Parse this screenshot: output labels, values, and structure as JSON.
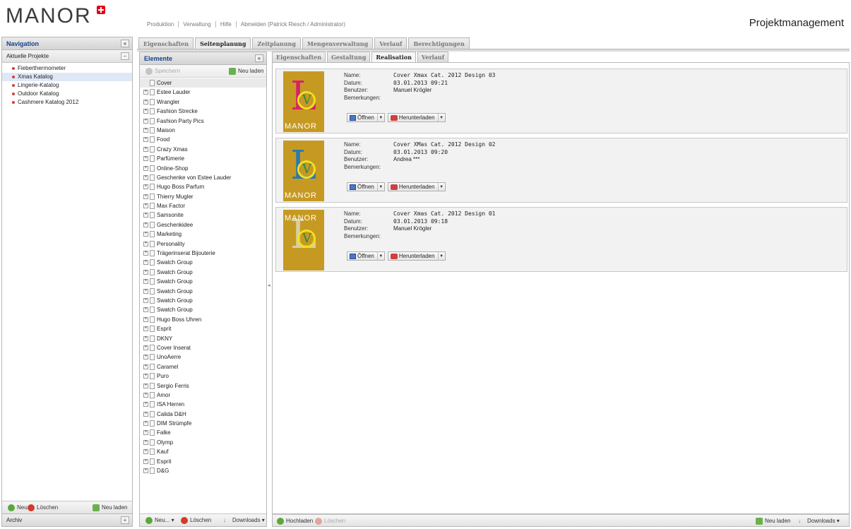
{
  "header": {
    "logo": "MANOR",
    "app_title": "Projektmanagement",
    "topnav": [
      "Produktion",
      "Verwaltung",
      "Hilfe",
      "Abmelden (Patrick Riesch / Administrator)"
    ]
  },
  "navigation": {
    "title": "Navigation",
    "section": "Aktuelle Projekte",
    "projects": [
      "Fieberthermometer",
      "Xmas Katalog",
      "Lingerie-Katalog",
      "Outdoor Katalog",
      "Cashmere Katalog 2012"
    ],
    "selected_project": "Xmas Katalog",
    "footer": {
      "new": "Neu",
      "delete": "Löschen",
      "reload": "Neu laden"
    },
    "archive": "Archiv"
  },
  "main_tabs": [
    "Eigenschaften",
    "Seitenplanung",
    "Zeitplanung",
    "Mengenverwaltung",
    "Verlauf",
    "Berechtigungen"
  ],
  "main_tab_active": "Seitenplanung",
  "elements": {
    "title": "Elemente",
    "save": "Speichern",
    "reload": "Neu laden",
    "items": [
      "Cover",
      "Estee Lauder",
      "Wrangler",
      "Fashion Strecke",
      "Fashion Party Pics",
      "Maison",
      "Food",
      "Crazy Xmas",
      "Parfümerie",
      "Online-Shop",
      "Geschenke von Estee Lauder",
      "Hugo Boss Parfum",
      "Thierry Mugler",
      "Max Factor",
      "Samsonite",
      "Geschenkidee",
      "Marketing",
      "Personality",
      "Trägerinserat Bijouterie",
      "Swatch Group",
      "Swatch Group",
      "Swatch Group",
      "Swatch Group",
      "Swatch Group",
      "Swatch Group",
      "Hugo Boss Uhren",
      "Esprit",
      "DKNY",
      "Cover Inserat",
      "UnoAerre",
      "Caramel",
      "Puro",
      "Sergio Ferris",
      "Amor",
      "ISA Herren",
      "Calida D&H",
      "DIM Strümpfe",
      "Falke",
      "Olymp",
      "Kauf",
      "Esprit",
      "D&G"
    ],
    "footer": {
      "new": "Neu...",
      "delete": "Löschen",
      "downloads": "Downloads"
    }
  },
  "sub_tabs": [
    "Eigenschaften",
    "Gestaltung",
    "Realisation",
    "Verlauf"
  ],
  "sub_tab_active": "Realisation",
  "labels": {
    "name": "Name:",
    "date": "Datum:",
    "user": "Benutzer:",
    "remarks": "Bemerkungen:",
    "open": "Öffnen",
    "download": "Herunterladen"
  },
  "designs": [
    {
      "name": "Cover Xmax Cat. 2012 Design 03",
      "date": "03.01.2013 09:21",
      "user": "Manuel Krögler",
      "remarks": "",
      "thumb_logo": "MANOR",
      "letter_color": "#d8206a"
    },
    {
      "name": "Cover XMas Cat. 2012 Design 02",
      "date": "03.01.2013 09:20",
      "user": "Andrea ***",
      "remarks": "",
      "thumb_logo": "MANOR",
      "letter_color": "#2a7ab0"
    },
    {
      "name": "Cover Xmas Cat. 2012 Design 01",
      "date": "03.01.2013 09:18",
      "user": "Manuel Krögler",
      "remarks": "",
      "thumb_logo": "MANOR",
      "letter_color": "#d8d0a0"
    }
  ],
  "content_footer": {
    "upload": "Hochladen",
    "delete": "Löschen",
    "reload": "Neu laden",
    "downloads": "Downloads"
  },
  "colors": {
    "brand_red": "#e2001a",
    "header_blue": "#15428b",
    "thumb_gold": "#c69a22"
  },
  "icons": {
    "add": "green-plus-icon",
    "delete": "red-minus-icon",
    "reload": "reload-icon",
    "download": "download-arrow-icon",
    "collapse": "double-chevron-left-icon",
    "open": "window-icon"
  }
}
